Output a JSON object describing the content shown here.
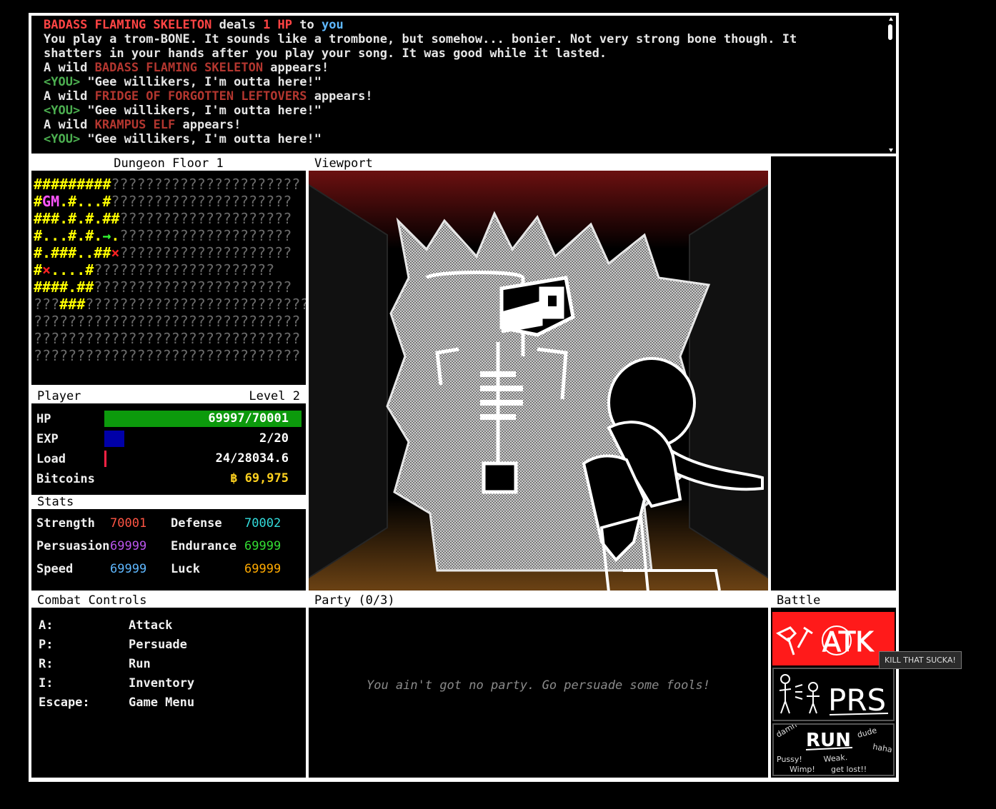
{
  "log": {
    "lines": [
      [
        {
          "t": "BADASS FLAMING SKELETON",
          "c": "c-red"
        },
        {
          "t": " deals ",
          "c": "c-white"
        },
        {
          "t": "1 HP",
          "c": "c-red"
        },
        {
          "t": " to ",
          "c": "c-white"
        },
        {
          "t": "you",
          "c": "c-blue"
        }
      ],
      [
        {
          "t": "You play a trom-BONE. It sounds like a trombone, but somehow... bonier. Not very strong bone though. It",
          "c": "c-white"
        }
      ],
      [
        {
          "t": "shatters in your hands after you play your song. It was good while it lasted.",
          "c": "c-white"
        }
      ],
      [
        {
          "t": "A wild ",
          "c": "c-white"
        },
        {
          "t": "BADASS FLAMING SKELETON",
          "c": "c-dred"
        },
        {
          "t": " appears!",
          "c": "c-white"
        }
      ],
      [
        {
          "t": "<YOU>",
          "c": "c-green"
        },
        {
          "t": " \"Gee willikers, I'm outta here!\"",
          "c": "c-white"
        }
      ],
      [
        {
          "t": "A wild ",
          "c": "c-white"
        },
        {
          "t": "FRIDGE OF FORGOTTEN LEFTOVERS",
          "c": "c-dred"
        },
        {
          "t": " appears!",
          "c": "c-white"
        }
      ],
      [
        {
          "t": "<YOU>",
          "c": "c-green"
        },
        {
          "t": " \"Gee willikers, I'm outta here!\"",
          "c": "c-white"
        }
      ],
      [
        {
          "t": "A wild ",
          "c": "c-white"
        },
        {
          "t": "KRAMPUS ELF",
          "c": "c-dred"
        },
        {
          "t": " appears!",
          "c": "c-white"
        }
      ],
      [
        {
          "t": "<YOU>",
          "c": "c-green"
        },
        {
          "t": " \"Gee willikers, I'm outta here!\"",
          "c": "c-white"
        }
      ]
    ]
  },
  "map": {
    "title": "Dungeon Floor 1",
    "rows": [
      [
        [
          "#########",
          "m-wall"
        ],
        [
          "??????????????????????",
          "m-unk"
        ]
      ],
      [
        [
          "#",
          "m-wall"
        ],
        [
          "GM",
          "m-gm"
        ],
        [
          ".#...#",
          "m-floor"
        ],
        [
          "?????????????????????",
          "m-unk"
        ]
      ],
      [
        [
          "###.#.#.##",
          "m-wall"
        ],
        [
          "????????????????????",
          "m-unk"
        ]
      ],
      [
        [
          "#...#.#.",
          "m-floor"
        ],
        [
          "→",
          "m-arrow"
        ],
        [
          ".",
          "m-floor"
        ],
        [
          "????????????????????",
          "m-unk"
        ]
      ],
      [
        [
          "#.###..##",
          "m-wall"
        ],
        [
          "×",
          "m-x"
        ],
        [
          "????????????????????",
          "m-unk"
        ]
      ],
      [
        [
          "#",
          "m-wall"
        ],
        [
          "×",
          "m-x"
        ],
        [
          "....#",
          "m-floor"
        ],
        [
          "?????????????????????",
          "m-unk"
        ]
      ],
      [
        [
          "####.##",
          "m-wall"
        ],
        [
          "???????????????????????",
          "m-unk"
        ]
      ],
      [
        [
          "???",
          "m-unk"
        ],
        [
          "###",
          "m-wall"
        ],
        [
          "??????????????????????????",
          "m-unk"
        ]
      ],
      [
        [
          "???????????????????????????????",
          "m-unk"
        ]
      ],
      [
        [
          "???????????????????????????????",
          "m-unk"
        ]
      ],
      [
        [
          "???????????????????????????????",
          "m-unk"
        ]
      ]
    ]
  },
  "viewport": {
    "title": "Viewport"
  },
  "player": {
    "title": "Player",
    "level": "Level 2",
    "hp": {
      "label": "HP",
      "value": "69997/70001",
      "fraction": 0.99994,
      "color": "#0c9a0c"
    },
    "exp": {
      "label": "EXP",
      "value": "2/20",
      "fraction": 0.1,
      "color": "#0000a8"
    },
    "load": {
      "label": "Load",
      "value": "24/28034.6",
      "fraction": 0.0009,
      "color": "#ff2244"
    },
    "bitcoins": {
      "label": "Bitcoins",
      "value": "฿ 69,975"
    }
  },
  "stats": {
    "title": "Stats",
    "items": [
      {
        "label": "Strength",
        "value": "70001",
        "color": "#ff5544"
      },
      {
        "label": "Defense",
        "value": "70002",
        "color": "#33dddd"
      },
      {
        "label": "Persuasion",
        "value": "69999",
        "color": "#bb55ee"
      },
      {
        "label": "Endurance",
        "value": "69999",
        "color": "#33dd33"
      },
      {
        "label": "Speed",
        "value": "69999",
        "color": "#5fb8ff"
      },
      {
        "label": "Luck",
        "value": "69999",
        "color": "#ffaa00"
      }
    ]
  },
  "controls": {
    "title": "Combat Controls",
    "items": [
      {
        "key": "A:",
        "action": "Attack"
      },
      {
        "key": "P:",
        "action": "Persuade"
      },
      {
        "key": "R:",
        "action": "Run"
      },
      {
        "key": "I:",
        "action": "Inventory"
      },
      {
        "key": "Escape:",
        "action": "Game Menu"
      }
    ]
  },
  "party": {
    "title": "Party (0/3)",
    "empty": "You ain't got no party. Go persuade some fools!"
  },
  "battle": {
    "title": "Battle",
    "atk": "ATK",
    "prs": "PRS",
    "run": "RUN",
    "run_scribbles": [
      "damn",
      "dude",
      "haha",
      "Pussy!",
      "Weak.",
      "Wimp!",
      "get lost!!"
    ],
    "tooltip": "KILL THAT SUCKA!"
  }
}
